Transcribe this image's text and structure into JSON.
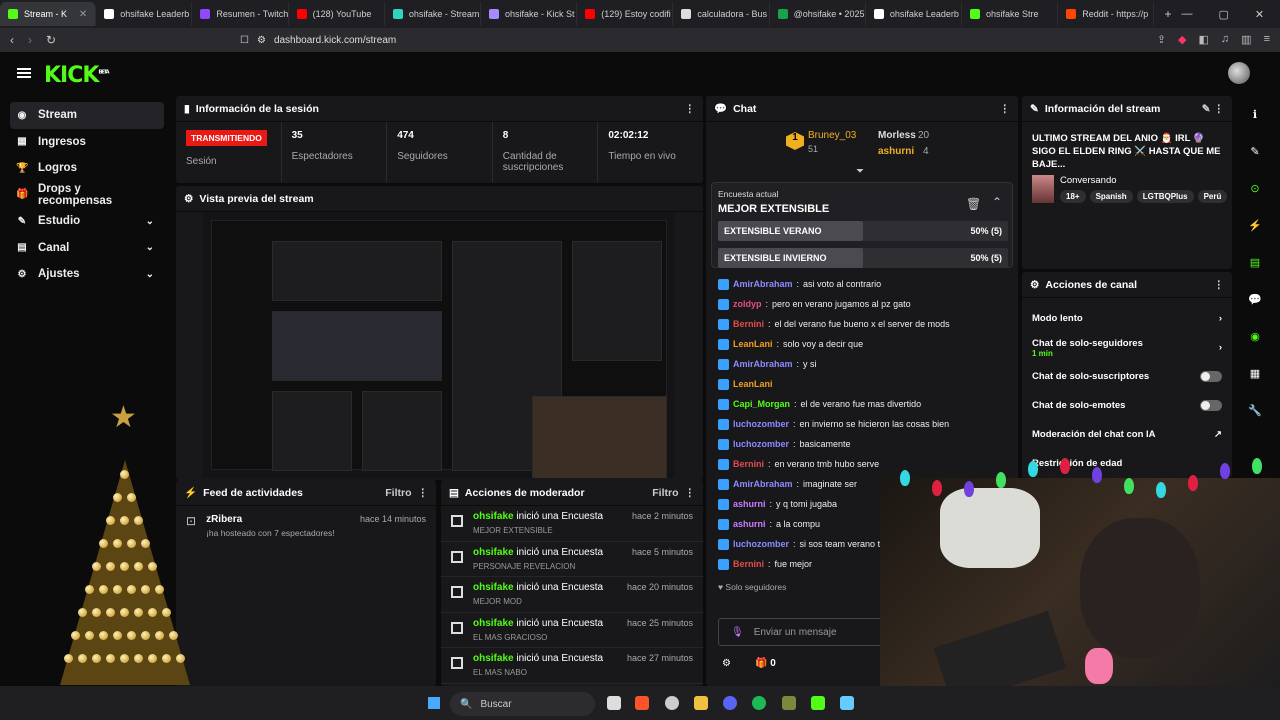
{
  "browser": {
    "tabs": [
      {
        "label": "Stream - K",
        "color": "#53fc18",
        "active": true
      },
      {
        "label": "ohsifake Leaderb",
        "color": "#ffffff"
      },
      {
        "label": "Resumen - Twitch",
        "color": "#9146ff"
      },
      {
        "label": "(128) YouTube",
        "color": "#ff0000"
      },
      {
        "label": "ohsifake - Stream",
        "color": "#2dd4bf"
      },
      {
        "label": "ohsifake - Kick St",
        "color": "#a78bfa"
      },
      {
        "label": "(129) Estoy codifi",
        "color": "#ff0000"
      },
      {
        "label": "calculadora - Bus",
        "color": "#dddddd"
      },
      {
        "label": "@ohsifake • 2025",
        "color": "#16a34a"
      },
      {
        "label": "ohsifake Leaderb",
        "color": "#ffffff"
      },
      {
        "label": "ohsifake Stre",
        "color": "#53fc18"
      },
      {
        "label": "Reddit - https://p",
        "color": "#ff4500"
      }
    ],
    "url": "dashboard.kick.com/stream"
  },
  "nav": {
    "logo": "KICK",
    "logo_beta": "BETA",
    "items": [
      {
        "label": "Stream",
        "icon": "stream-icon"
      },
      {
        "label": "Ingresos",
        "icon": "money-icon"
      },
      {
        "label": "Logros",
        "icon": "trophy-icon"
      },
      {
        "label": "Drops y recompensas",
        "icon": "gift-icon"
      },
      {
        "label": "Estudio",
        "icon": "studio-icon"
      },
      {
        "label": "Canal",
        "icon": "channel-icon"
      },
      {
        "label": "Ajustes",
        "icon": "gear-icon"
      }
    ]
  },
  "session": {
    "title": "Información de la sesión",
    "status": "TRANSMITIENDO",
    "status_label": "Sesión",
    "stats": [
      {
        "value": "35",
        "label": "Espectadores"
      },
      {
        "value": "474",
        "label": "Seguidores"
      },
      {
        "value": "8",
        "label": "Cantidad de suscripciones"
      },
      {
        "value": "02:02:12",
        "label": "Tiempo en vivo"
      }
    ]
  },
  "preview": {
    "title": "Vista previa del stream"
  },
  "feed": {
    "title": "Feed de actividades",
    "filter": "Filtro",
    "items": [
      {
        "user": "zRibera",
        "text": "¡ha hosteado con 7 espectadores!",
        "time": "hace 14 minutos"
      }
    ]
  },
  "mod": {
    "title": "Acciones de moderador",
    "filter": "Filtro",
    "items": [
      {
        "user": "ohsifake",
        "action": "inició una Encuesta",
        "detail": "MEJOR EXTENSIBLE",
        "time": "hace 2 minutos"
      },
      {
        "user": "ohsifake",
        "action": "inició una Encuesta",
        "detail": "PERSONAJE REVELACION",
        "time": "hace 5 minutos"
      },
      {
        "user": "ohsifake",
        "action": "inició una Encuesta",
        "detail": "MEJOR MOD",
        "time": "hace 20 minutos"
      },
      {
        "user": "ohsifake",
        "action": "inició una Encuesta",
        "detail": "EL MAS GRACIOSO",
        "time": "hace 25 minutos"
      },
      {
        "user": "ohsifake",
        "action": "inició una Encuesta",
        "detail": "EL MAS NABO",
        "time": "hace 27 minutos"
      }
    ]
  },
  "chat": {
    "title": "Chat",
    "leaders": [
      {
        "rank": "1",
        "name": "Bruney_03",
        "count": "51"
      },
      {
        "name": "Morless",
        "count": "20"
      },
      {
        "name": "ashurni",
        "count": "4"
      }
    ],
    "poll": {
      "label": "Encuesta actual",
      "question": "MEJOR EXTENSIBLE",
      "options": [
        {
          "text": "EXTENSIBLE VERANO",
          "result": "50% (5)",
          "fraction": 0.5
        },
        {
          "text": "EXTENSIBLE INVIERNO",
          "result": "50% (5)",
          "fraction": 0.5
        }
      ]
    },
    "messages": [
      {
        "user": "AmirAbraham",
        "color": "#8b8bff",
        "text": "asi voto al contrario"
      },
      {
        "user": "zoldyp",
        "color": "#e44d8a",
        "text": "pero en verano jugamos al pz gato"
      },
      {
        "user": "Bernini",
        "color": "#e44d4d",
        "text": "el del verano fue bueno x el server de mods"
      },
      {
        "user": "LeanLani",
        "color": "#f0a020",
        "text": "solo voy a decir que"
      },
      {
        "user": "AmirAbraham",
        "color": "#8b8bff",
        "text": "y si"
      },
      {
        "user": "LeanLani",
        "color": "#f0a020",
        "text": ""
      },
      {
        "user": "Capi_Morgan",
        "color": "#53fc18",
        "text": "el de verano fue mas divertido"
      },
      {
        "user": "luchozomber",
        "color": "#8b8bff",
        "text": "en invierno se hicieron las cosas bien"
      },
      {
        "user": "luchozomber",
        "color": "#8b8bff",
        "text": "basicamente"
      },
      {
        "user": "Bernini",
        "color": "#e44d4d",
        "text": "en verano tmb hubo serve"
      },
      {
        "user": "AmirAbraham",
        "color": "#8b8bff",
        "text": "imaginate ser"
      },
      {
        "user": "ashurni",
        "color": "#c77dff",
        "text": "y q tomi jugaba"
      },
      {
        "user": "ashurni",
        "color": "#c77dff",
        "text": "a la compu"
      },
      {
        "user": "luchozomber",
        "color": "#8b8bff",
        "text": "si sos team verano te"
      },
      {
        "user": "Bernini",
        "color": "#e44d4d",
        "text": "fue mejor"
      }
    ],
    "followers_only": "Solo seguidores",
    "input_placeholder": "Enviar un mensaje",
    "points": "0"
  },
  "stream_info": {
    "title": "Información del stream",
    "stream_title": "ULTIMO STREAM DEL ANIO 🎅 IRL 🔮 SIGO EL ELDEN RING ⚔️ HASTA QUE ME BAJE...",
    "category": "Conversando",
    "tags": [
      "18+",
      "Spanish",
      "LGTBQPlus",
      "Perú"
    ]
  },
  "channel_actions": {
    "title": "Acciones de canal",
    "items": [
      {
        "label": "Modo lento",
        "control": "arrow"
      },
      {
        "label": "Chat de solo-seguidores",
        "sub": "1 min",
        "control": "arrow"
      },
      {
        "label": "Chat de solo-suscriptores",
        "control": "switch"
      },
      {
        "label": "Chat de solo-emotes",
        "control": "switch"
      },
      {
        "label": "Moderación del chat con IA",
        "control": "link"
      },
      {
        "label": "Restricción de edad",
        "control": "none"
      }
    ]
  },
  "taskbar": {
    "search": "Buscar"
  }
}
